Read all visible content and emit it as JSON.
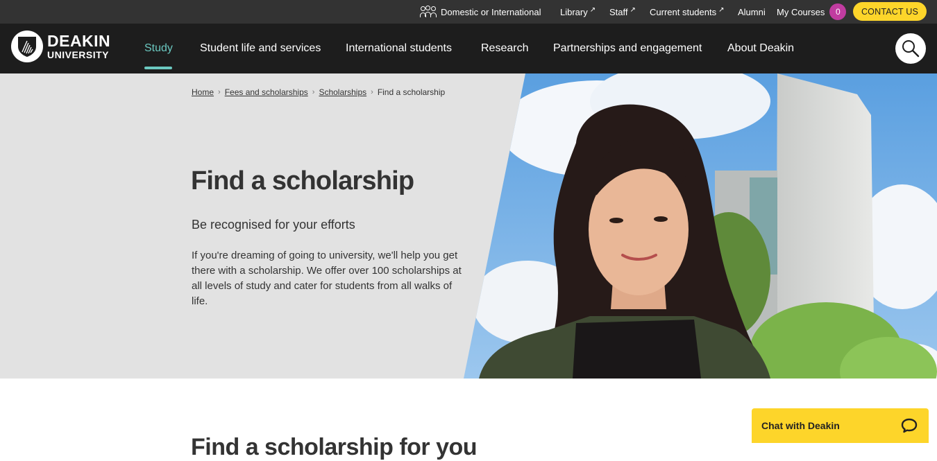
{
  "utility_bar": {
    "domestic_label": "Domestic or International",
    "library_label": "Library",
    "staff_label": "Staff",
    "current_students_label": "Current students",
    "alumni_label": "Alumni",
    "my_courses_label": "My Courses",
    "my_courses_count": "0",
    "contact_label": "CONTACT US"
  },
  "logo": {
    "line1": "DEAKIN",
    "line2": "UNIVERSITY"
  },
  "nav": {
    "items": [
      {
        "label": "Study"
      },
      {
        "label": "Student life and services"
      },
      {
        "label": "International students"
      },
      {
        "label": "Research"
      },
      {
        "label": "Partnerships and engagement"
      },
      {
        "label": "About Deakin"
      }
    ],
    "active": "Study"
  },
  "breadcrumb": {
    "items": [
      {
        "label": "Home"
      },
      {
        "label": "Fees and scholarships"
      },
      {
        "label": "Scholarships"
      },
      {
        "label": "Find a scholarship"
      }
    ],
    "separator": "›"
  },
  "hero": {
    "title": "Find a scholarship",
    "subtitle": "Be recognised for your efforts",
    "body": "If you're dreaming of going to university, we'll help you get there with a scholarship. We offer over 100 scholarships at all levels of study and cater for students from all walks of life."
  },
  "next_section": {
    "heading": "Find a scholarship for you"
  },
  "chat": {
    "label": "Chat with Deakin"
  },
  "colors": {
    "accent_teal": "#6bc8c0",
    "brand_yellow": "#fdd52a",
    "badge_magenta": "#c13ca0",
    "nav_bg": "#1d1d1d",
    "utility_bg": "#333333",
    "hero_bg": "#e2e2e2"
  },
  "icons": {
    "people": "people-icon",
    "external_link": "external-link-icon",
    "search": "search-icon",
    "chat": "chat-bubble-icon"
  }
}
